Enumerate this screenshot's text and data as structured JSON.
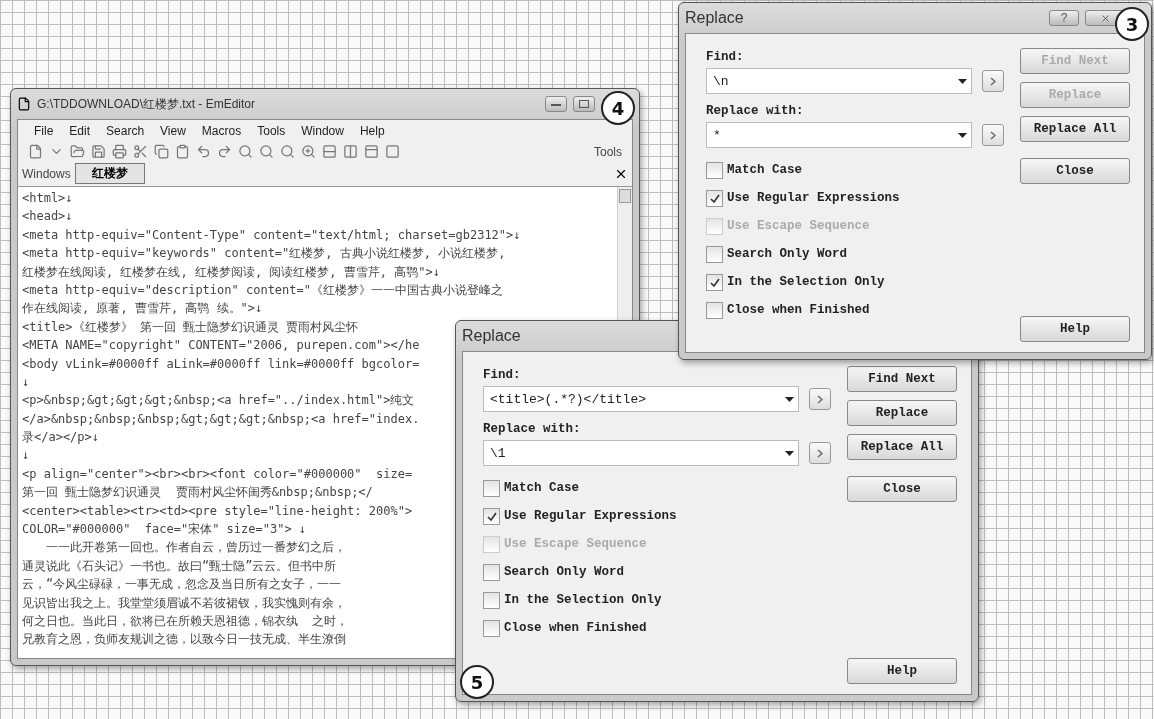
{
  "editor": {
    "title": "G:\\TDDOWNLOAD\\红楼梦.txt - EmEditor",
    "callout": "4",
    "menu": [
      "File",
      "Edit",
      "Search",
      "View",
      "Macros",
      "Tools",
      "Window",
      "Help"
    ],
    "toolbar_label": "Tools",
    "windows_label": "Windows",
    "doc_tabs": [
      {
        "label": "红楼梦",
        "selected": true
      }
    ],
    "lines": [
      "<html>↓",
      "<head>↓",
      "<meta http-equiv=\"Content-Type\" content=\"text/html; charset=gb2312\">↓",
      "<meta http-equiv=\"keywords\" content=\"红楼梦, 古典小说红楼梦, 小说红楼梦,",
      "红楼梦在线阅读, 红楼梦在线, 红楼梦阅读, 阅读红楼梦, 曹雪芹, 高鹗\">↓",
      "<meta http-equiv=\"description\" content=\"《红楼梦》一一中国古典小说登峰之",
      "作在线阅读, 原著, 曹雪芹, 高鹗 续。\">↓",
      "<title>《红楼梦》 第一回 甄士隐梦幻识通灵 贾雨村风尘怀",
      "<META NAME=\"copyright\" CONTENT=\"2006, purepen.com\"></he",
      "<body vLink=#0000ff aLink=#0000ff link=#0000ff bgcolor=",
      "↓",
      "<p>&nbsp;&gt;&gt;&gt;&nbsp;<a href=\"../index.html\">纯文",
      "</a>&nbsp;&nbsp;&nbsp;&gt;&gt;&gt;&nbsp;<a href=\"index.",
      "录</a></p>↓",
      "↓",
      "<p align=\"center\"><br><br><font color=\"#000000\"  size=",
      "第一回 甄士隐梦幻识通灵  贾雨村风尘怀闺秀&nbsp;&nbsp;</",
      "<center><table><tr><td><pre style=\"line-height: 200%\">",
      "COLOR=\"#000000\"  face=\"宋体\" size=\"3\"> ↓",
      "　　一一此开卷第一回也。作者自云，曾历过一番梦幻之后，",
      "通灵说此《石头记》一书也。故曰“甄士隐”云云。但书中所",
      "云，“今风尘碌碌，一事无成，忽念及当日所有之女子，一一",
      "见识皆出我之上。我堂堂须眉诚不若彼裙钗，我实愧则有余，",
      "何之日也。当此日，欲将已在所赖天恩祖德，锦衣纨  之时，",
      "兄教育之恩，负师友规训之德，以致今日一技无成、半生潦倒"
    ]
  },
  "dialogs": [
    {
      "title": "Replace",
      "callout": "5",
      "find_label": "Find:",
      "find_value": "<title>(.*?)</title>",
      "replace_label": "Replace with:",
      "replace_value": "\\1",
      "buttons": [
        {
          "label": "Find Next",
          "disabled": false
        },
        {
          "label": "Replace",
          "disabled": false
        },
        {
          "label": "Replace All",
          "disabled": false
        },
        {
          "label": "Close",
          "disabled": false
        }
      ],
      "help": "Help",
      "options": [
        {
          "label": "Match Case",
          "checked": false,
          "disabled": false
        },
        {
          "label": "Use Regular Expressions",
          "checked": true,
          "disabled": false
        },
        {
          "label": "Use Escape Sequence",
          "checked": false,
          "disabled": true
        },
        {
          "label": "Search Only Word",
          "checked": false,
          "disabled": false
        },
        {
          "label": "In the Selection Only",
          "checked": false,
          "disabled": false
        },
        {
          "label": "Close when Finished",
          "checked": false,
          "disabled": false
        }
      ]
    },
    {
      "title": "Replace",
      "callout": "3",
      "help_glyph": "?",
      "find_label": "Find:",
      "find_value": "\\n",
      "replace_label": "Replace with:",
      "replace_value": "*",
      "buttons": [
        {
          "label": "Find Next",
          "disabled": true
        },
        {
          "label": "Replace",
          "disabled": true
        },
        {
          "label": "Replace All",
          "disabled": false
        },
        {
          "label": "Close",
          "disabled": false
        }
      ],
      "help": "Help",
      "options": [
        {
          "label": "Match Case",
          "checked": false,
          "disabled": false
        },
        {
          "label": "Use Regular Expressions",
          "checked": true,
          "disabled": false
        },
        {
          "label": "Use Escape Sequence",
          "checked": false,
          "disabled": true
        },
        {
          "label": "Search Only Word",
          "checked": false,
          "disabled": false
        },
        {
          "label": "In the Selection Only",
          "checked": true,
          "disabled": false
        },
        {
          "label": "Close when Finished",
          "checked": false,
          "disabled": false
        }
      ]
    }
  ]
}
